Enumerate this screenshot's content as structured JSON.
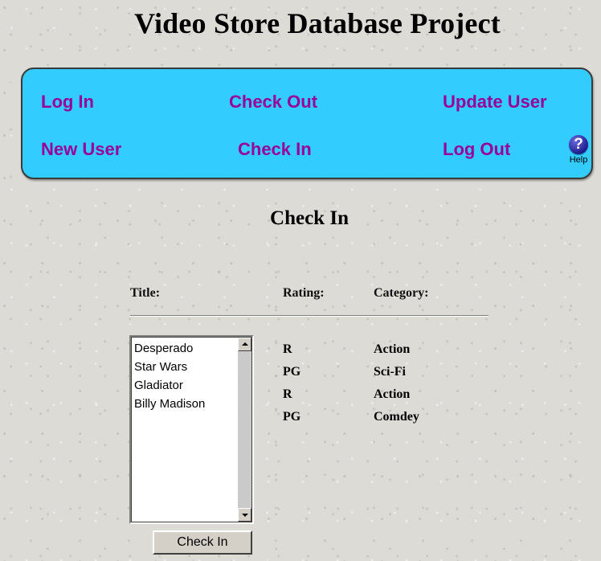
{
  "page": {
    "title": "Video Store Database Project"
  },
  "nav": {
    "log_in": "Log In",
    "check_out": "Check Out",
    "update_user": "Update User",
    "new_user": "New User",
    "check_in": "Check In",
    "log_out": "Log Out",
    "help_label": "Help",
    "help_glyph": "?"
  },
  "checkin": {
    "heading": "Check In",
    "headers": {
      "title": "Title:",
      "rating": "Rating:",
      "category": "Category:"
    },
    "movies": [
      {
        "title": "Desperado",
        "rating": "R",
        "category": "Action"
      },
      {
        "title": "Star Wars",
        "rating": "PG",
        "category": "Sci-Fi"
      },
      {
        "title": "Gladiator",
        "rating": "R",
        "category": "Action"
      },
      {
        "title": "Billy Madison",
        "rating": "PG",
        "category": "Comdey"
      }
    ],
    "button_label": "Check In"
  },
  "colors": {
    "nav_background": "#33ccff",
    "nav_link": "#990099",
    "help_icon": "#1d1d8c"
  },
  "icons": {
    "help": "question-mark-circle-icon",
    "scroll_up": "triangle-up-icon",
    "scroll_down": "triangle-down-icon"
  }
}
